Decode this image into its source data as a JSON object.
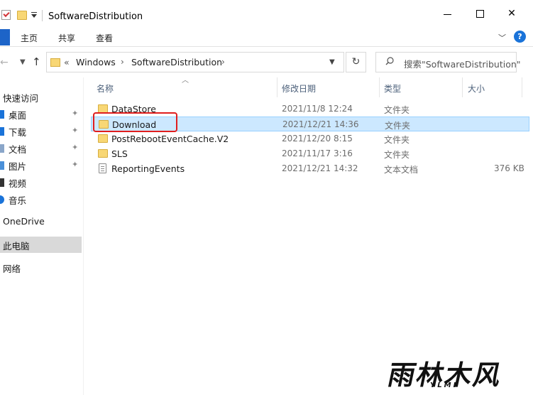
{
  "window": {
    "title": "SoftwareDistribution",
    "close_glyph": "✕"
  },
  "ribbon": {
    "tabs": [
      "主页",
      "共享",
      "查看"
    ],
    "help_glyph": "?"
  },
  "address": {
    "overflow": "«",
    "crumbs": [
      "Windows",
      "SoftwareDistribution"
    ],
    "separator": "›",
    "search_placeholder": "搜索\"SoftwareDistribution\""
  },
  "nav_pane": {
    "items": [
      {
        "label": "快速访问",
        "pinned": false,
        "color": "#1a73d9"
      },
      {
        "label": "桌面",
        "pinned": true,
        "color": "#1a73d9"
      },
      {
        "label": "下载",
        "pinned": true,
        "color": "#1a73d9"
      },
      {
        "label": "文档",
        "pinned": true,
        "color": "#1a73d9"
      },
      {
        "label": "图片",
        "pinned": true,
        "color": "#1a73d9"
      },
      {
        "label": "视频",
        "pinned": false,
        "color": "#333333"
      },
      {
        "label": "音乐",
        "pinned": false,
        "color": "#1a73d9"
      },
      {
        "label": "OneDrive",
        "pinned": false,
        "color": ""
      },
      {
        "label": "此电脑",
        "pinned": false,
        "color": "",
        "selected": true
      },
      {
        "label": "网络",
        "pinned": false,
        "color": ""
      }
    ],
    "pin_glyph": "📌"
  },
  "file_list": {
    "columns": [
      "名称",
      "修改日期",
      "类型",
      "大小"
    ],
    "rows": [
      {
        "name": "DataStore",
        "date": "2021/11/8 12:24",
        "type": "文件夹",
        "size": "",
        "icon": "folder-icon"
      },
      {
        "name": "Download",
        "date": "2021/12/21 14:36",
        "type": "文件夹",
        "size": "",
        "icon": "folder-icon",
        "selected": true
      },
      {
        "name": "PostRebootEventCache.V2",
        "date": "2021/12/20 8:15",
        "type": "文件夹",
        "size": "",
        "icon": "folder-icon"
      },
      {
        "name": "SLS",
        "date": "2021/11/17 3:16",
        "type": "文件夹",
        "size": "",
        "icon": "folder-icon"
      },
      {
        "name": "ReportingEvents",
        "date": "2021/12/21 14:32",
        "type": "文本文档",
        "size": "376 KB",
        "icon": "text-file-icon"
      }
    ]
  },
  "watermark": {
    "main": "雨林木风",
    "sub": "YLMF"
  },
  "colors": {
    "accent": "#1a73d9",
    "selection": "#cce8ff",
    "highlight": "#e01e1e",
    "folder": "#f8d775"
  }
}
